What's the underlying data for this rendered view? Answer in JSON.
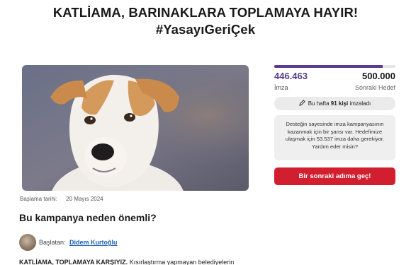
{
  "header": {
    "title_line1": "KATLİAMA, BARINAKLARA TOPLAMAYA HAYIR!",
    "title_line2": "#YasayıGeriÇek"
  },
  "campaign": {
    "started_label": "Başlama tarihi:",
    "started_date": "20 Mayıs 2024",
    "section_heading": "Bu kampanya neden önemli?",
    "starter_prefix": "Başlatan:",
    "starter_name": "Didem Kurtoğlu",
    "body_bold": "KATLİAMA, TOPLAMAYA KARŞIYIZ.",
    "body_rest": " Kısırlaştırma yapmayan belediyelerin"
  },
  "signatures": {
    "count": "446.463",
    "count_label": "İmza",
    "goal": "500.000",
    "goal_label": "Sonraki Hedef",
    "progress_fraction": 0.893,
    "weekly_prefix": "Bu hafta",
    "weekly_count": "91 kişi",
    "weekly_suffix": "imzaladı"
  },
  "info": {
    "text": "Desteğin sayesinde imza kampanyasının kazanmak için bir şansı var. Hedefimize ulaşmak için 53.537 imza daha gerekiyor. Yardım eder misin?"
  },
  "cta": {
    "label": "Bir sonraki adıma geç!"
  },
  "colors": {
    "accent": "#5a3b8c",
    "cta": "#d21f2f"
  },
  "icons": {
    "weekly": "pen-icon"
  }
}
